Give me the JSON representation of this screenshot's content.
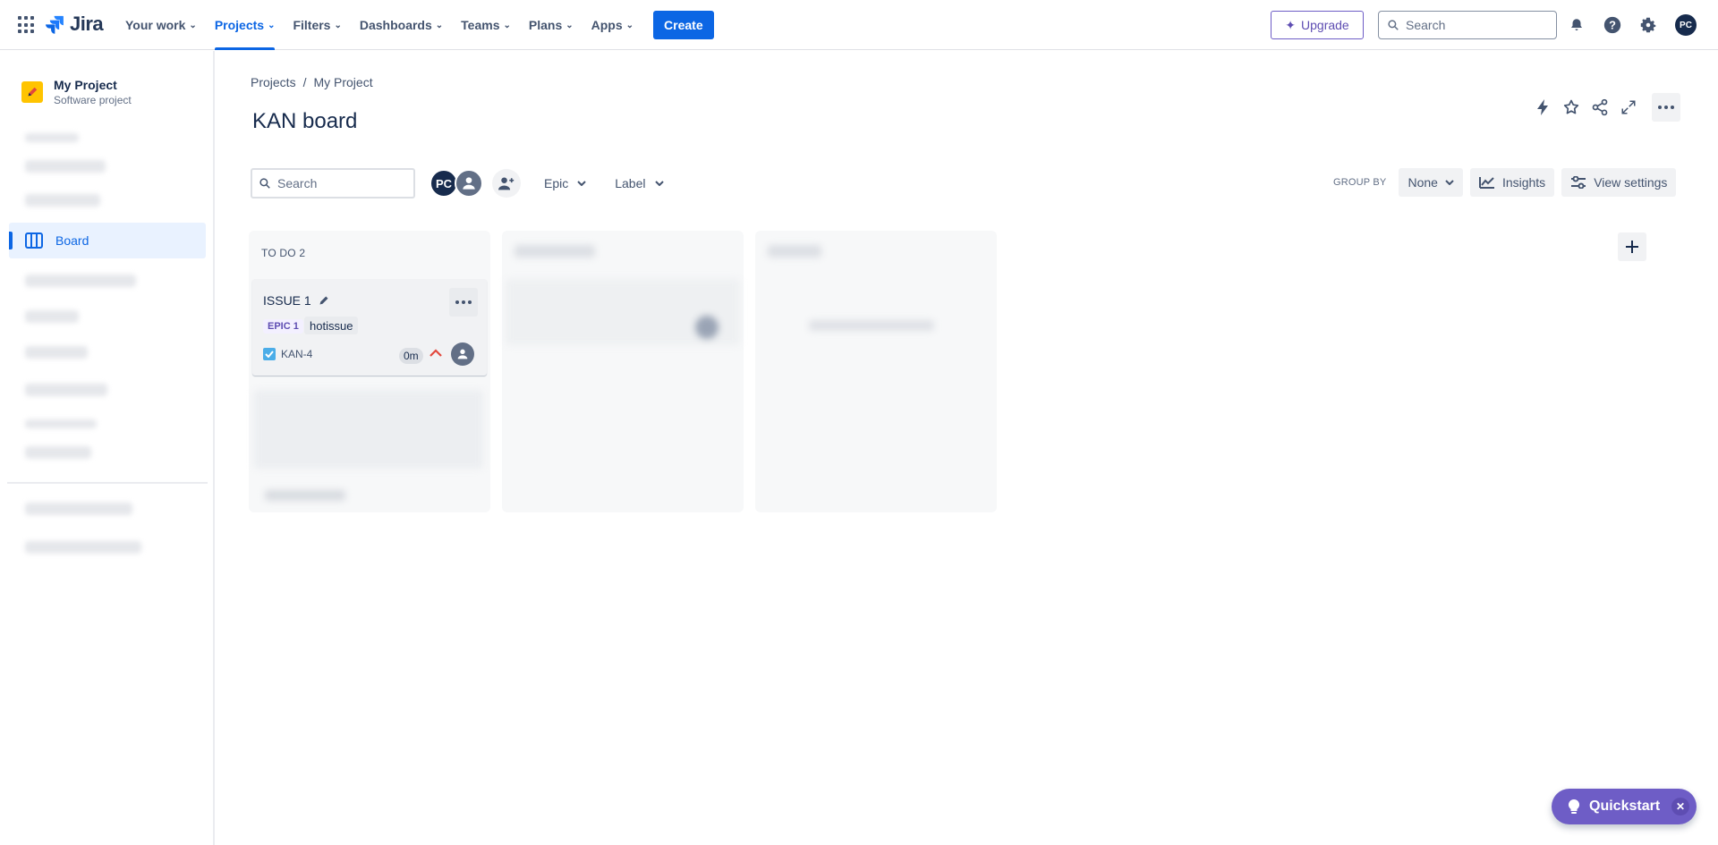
{
  "topnav": {
    "logo_text": "Jira",
    "items": [
      {
        "label": "Your work"
      },
      {
        "label": "Projects"
      },
      {
        "label": "Filters"
      },
      {
        "label": "Dashboards"
      },
      {
        "label": "Teams"
      },
      {
        "label": "Plans"
      },
      {
        "label": "Apps"
      }
    ],
    "create_label": "Create",
    "upgrade_label": "Upgrade",
    "search_placeholder": "Search",
    "user_initials": "PC",
    "accent": "#0c66e4"
  },
  "sidebar": {
    "project_name": "My Project",
    "project_type": "Software project",
    "active_item": "Board"
  },
  "main": {
    "breadcrumb": [
      "Projects",
      "My Project"
    ],
    "breadcrumb_sep": "/",
    "title": "KAN board",
    "search_placeholder": "Search",
    "avatar_initials": "PC",
    "filters": [
      "Epic",
      "Label"
    ],
    "group_by_label": "GROUP BY",
    "group_by_value": "None",
    "insights_label": "Insights",
    "view_settings_label": "View settings"
  },
  "board": {
    "columns": [
      {
        "title": "TO DO 2",
        "cards": [
          {
            "title": "ISSUE 1",
            "epic": "EPIC 1",
            "label": "hotissue",
            "key": "KAN-4",
            "estimate": "0m",
            "priority": "high"
          }
        ]
      }
    ]
  },
  "quickstart": {
    "label": "Quickstart",
    "color": "#6e5dc6"
  }
}
